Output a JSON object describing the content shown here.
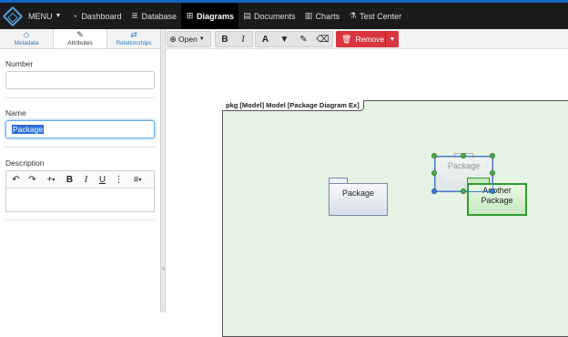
{
  "nav": {
    "menu_label": "MENU",
    "items": [
      {
        "label": "Dashboard",
        "icon": "dashboard-icon"
      },
      {
        "label": "Database",
        "icon": "database-icon"
      },
      {
        "label": "Diagrams",
        "icon": "diagram-icon",
        "active": true
      },
      {
        "label": "Documents",
        "icon": "document-icon"
      },
      {
        "label": "Charts",
        "icon": "chart-icon"
      },
      {
        "label": "Test Center",
        "icon": "flask-icon"
      }
    ]
  },
  "left_panel": {
    "tabs": [
      {
        "label": "Metadata",
        "icon": "tag-icon"
      },
      {
        "label": "Attributes",
        "icon": "edit-icon",
        "active": true
      },
      {
        "label": "Relationships",
        "icon": "swap-icon"
      }
    ],
    "number_label": "Number",
    "number_value": "",
    "name_label": "Name",
    "name_value": "Package",
    "description_label": "Description"
  },
  "toolbar": {
    "open_label": "Open",
    "remove_label": "Remove"
  },
  "diagram": {
    "frame_label": "pkg [Model] Model [Package Diagram Ex]",
    "package1_label": "Package",
    "package2_label": "Package",
    "package3_label_line1": "Another",
    "package3_label_line2": "Package"
  },
  "colors": {
    "nav_bg": "#1b1b1b",
    "accent": "#1565c0",
    "remove_red": "#d9363e",
    "frame_fill": "#e6f2e3",
    "selection_green": "#2f9d2f",
    "selection_blue": "#3d7bd9"
  }
}
